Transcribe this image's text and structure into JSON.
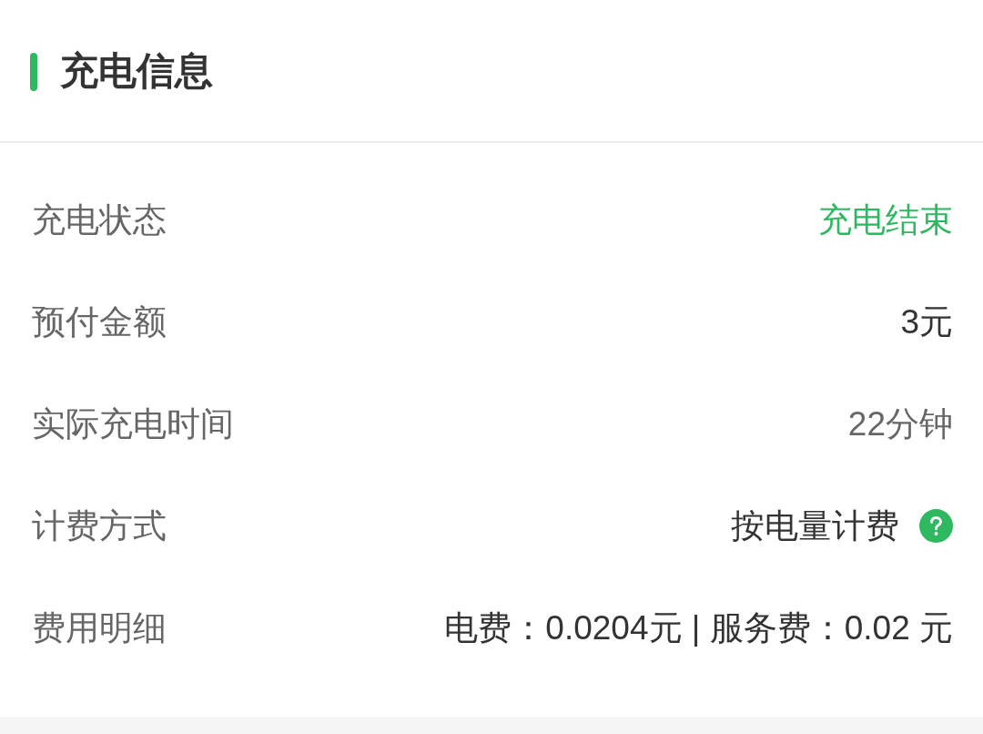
{
  "section": {
    "title": "充电信息"
  },
  "rows": [
    {
      "label": "充电状态",
      "value": "充电结束",
      "kind": "status"
    },
    {
      "label": "预付金额",
      "value": "3元",
      "kind": "strong"
    },
    {
      "label": "实际充电时间",
      "value": "22分钟",
      "kind": "muted"
    },
    {
      "label": "计费方式",
      "value": "按电量计费",
      "kind": "help"
    },
    {
      "label": "费用明细",
      "value": "电费：0.0204元 | 服务费：0.02 元",
      "kind": "strong"
    }
  ]
}
